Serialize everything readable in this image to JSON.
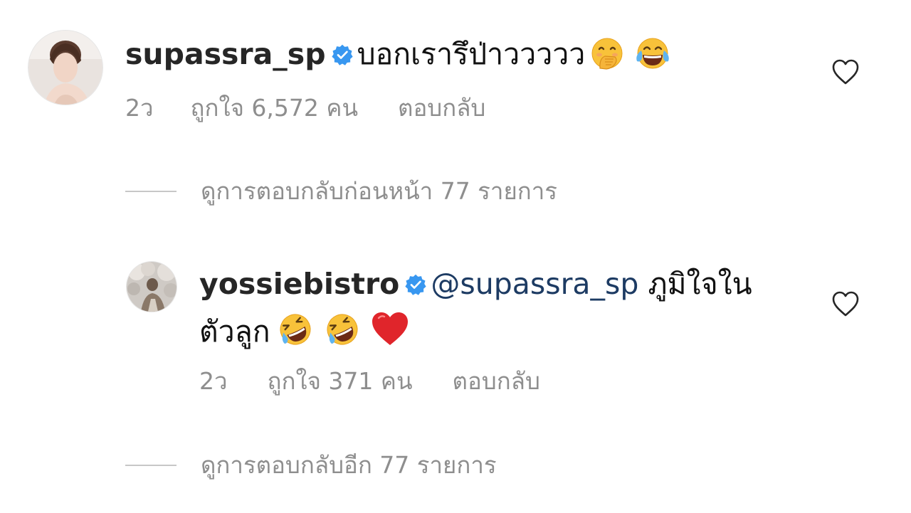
{
  "comments": [
    {
      "username": "supassra_sp",
      "verified": true,
      "text": "บอกเรารึป่าววววว",
      "emojis": [
        "face-with-hand-over-mouth",
        "face-with-tears-of-joy"
      ],
      "time": "2ว",
      "likes": "ถูกใจ 6,572 คน",
      "reply_label": "ตอบกลับ"
    },
    {
      "username": "yossiebistro",
      "verified": true,
      "mention": "@supassra_sp",
      "text_line1": "ภูมิใจใน",
      "text_line2": "ตัวลูก",
      "emojis": [
        "rolling-on-floor-laughing",
        "rolling-on-floor-laughing",
        "red-heart"
      ],
      "time": "2ว",
      "likes": "ถูกใจ 371 คน",
      "reply_label": "ตอบกลับ"
    }
  ],
  "view_previous_replies": "ดูการตอบกลับก่อนหน้า 77 รายการ",
  "view_more_replies": "ดูการตอบกลับอีก 77 รายการ",
  "colors": {
    "verified_badge": "#3897f0",
    "meta_text": "#8e8e8e",
    "mention": "#1d3b63",
    "heart_emoji": "#e0252b"
  }
}
